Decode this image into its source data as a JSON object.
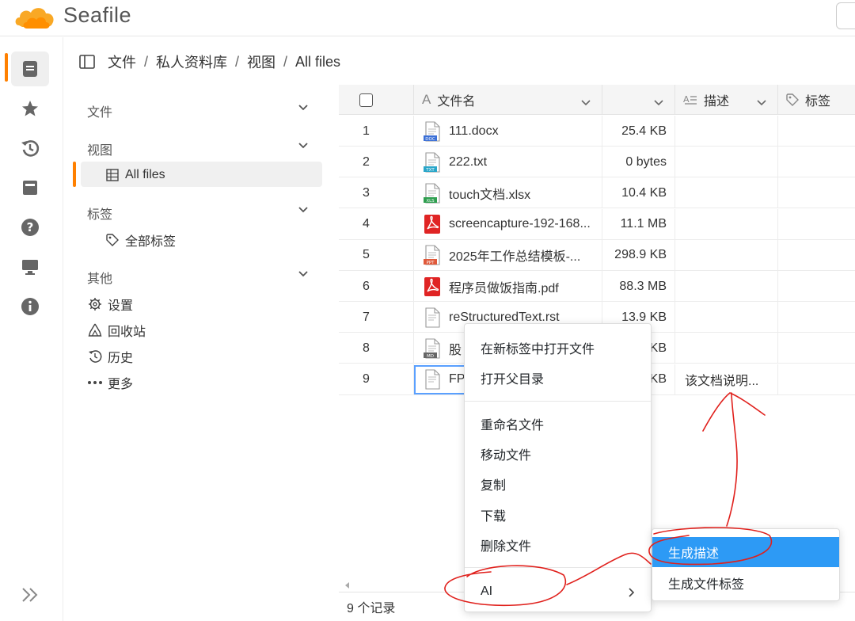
{
  "app": {
    "name": "Seafile",
    "brand_color": "#ff8000"
  },
  "leftnav": {
    "icons": [
      "files-icon",
      "star-icon",
      "history-icon",
      "wiki-icon",
      "help-icon",
      "desktop-icon",
      "info-icon"
    ],
    "collapse_icon": "double-chevron-right-icon"
  },
  "breadcrumb": {
    "items": [
      "文件",
      "私人资料库",
      "视图",
      "All files"
    ],
    "separator": "/"
  },
  "sidepanel": {
    "sections": [
      {
        "title": "文件"
      },
      {
        "title": "视图",
        "items": [
          "All files"
        ]
      },
      {
        "title": "标签",
        "items": [
          "全部标签"
        ]
      },
      {
        "title": "其他",
        "items": [
          "设置",
          "回收站",
          "历史",
          "更多"
        ]
      }
    ]
  },
  "grid": {
    "columns": [
      {
        "label": ""
      },
      {
        "label": "文件名"
      },
      {
        "label": ""
      },
      {
        "label": "描述"
      },
      {
        "label": "标签"
      }
    ],
    "rows": [
      {
        "idx": "1",
        "name": "111.docx",
        "type": "DOC",
        "size": "25.4 KB",
        "desc": ""
      },
      {
        "idx": "2",
        "name": "222.txt",
        "type": "TXT",
        "size": "0 bytes",
        "desc": ""
      },
      {
        "idx": "3",
        "name": "touch文档.xlsx",
        "type": "XLS",
        "size": "10.4 KB",
        "desc": ""
      },
      {
        "idx": "4",
        "name": "screencapture-192-168...",
        "type": "PDF",
        "size": "11.1 MB",
        "desc": ""
      },
      {
        "idx": "5",
        "name": "2025年工作总结模板-...",
        "type": "PPT",
        "size": "298.9 KB",
        "desc": ""
      },
      {
        "idx": "6",
        "name": "程序员做饭指南.pdf",
        "type": "PDF",
        "size": "88.3 MB",
        "desc": ""
      },
      {
        "idx": "7",
        "name": "reStructuredText.rst",
        "type": "RST",
        "size": "13.9 KB",
        "desc": ""
      },
      {
        "idx": "8",
        "name": "股",
        "type": "MD",
        "size": "KB",
        "desc": ""
      },
      {
        "idx": "9",
        "name": "FP",
        "type": "RST",
        "size": "KB",
        "desc": "该文档说明..."
      }
    ],
    "footer": "9 个记录"
  },
  "context_menu": {
    "items": [
      "在新标签中打开文件",
      "打开父目录",
      "重命名文件",
      "移动文件",
      "复制",
      "下载",
      "删除文件",
      "AI"
    ],
    "submenu": [
      "生成描述",
      "生成文件标签"
    ],
    "highlight_color": "#2d9af5"
  },
  "annotation_color": "#e0201c"
}
